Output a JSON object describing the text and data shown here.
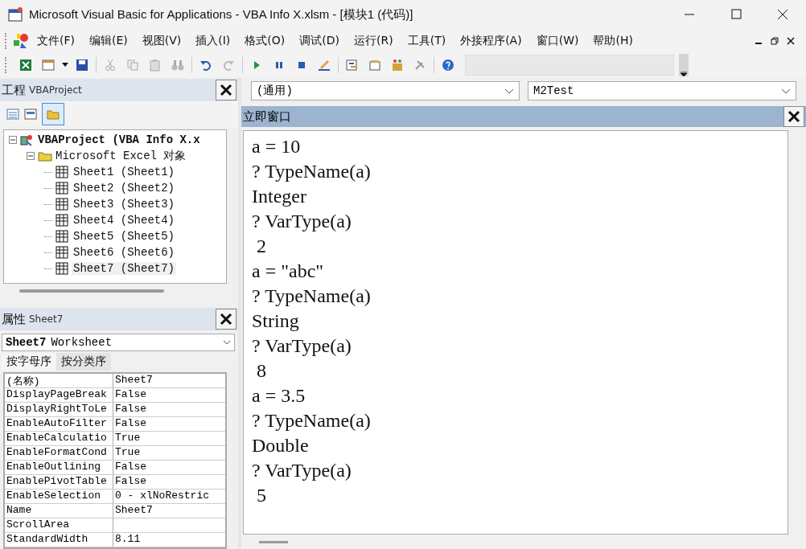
{
  "window": {
    "title": "Microsoft Visual Basic for Applications - VBA Info X.xlsm - [模块1 (代码)]"
  },
  "menu": [
    {
      "label": "文件(F)"
    },
    {
      "label": "编辑(E)"
    },
    {
      "label": "视图(V)"
    },
    {
      "label": "插入(I)"
    },
    {
      "label": "格式(O)"
    },
    {
      "label": "调试(D)"
    },
    {
      "label": "运行(R)"
    },
    {
      "label": "工具(T)"
    },
    {
      "label": "外接程序(A)"
    },
    {
      "label": "窗口(W)"
    },
    {
      "label": "帮助(H)"
    }
  ],
  "project": {
    "title": "工程",
    "subtitle": "VBAProject",
    "tree": [
      {
        "label": "VBAProject (VBA Info X.x",
        "kind": "project",
        "expanded": true,
        "selected": false,
        "children": [
          {
            "label": "Microsoft Excel 对象",
            "kind": "folder",
            "expanded": true,
            "selected": false,
            "children": [
              {
                "label": "Sheet1 (Sheet1)",
                "kind": "sheet",
                "selected": false
              },
              {
                "label": "Sheet2 (Sheet2)",
                "kind": "sheet",
                "selected": false
              },
              {
                "label": "Sheet3 (Sheet3)",
                "kind": "sheet",
                "selected": false
              },
              {
                "label": "Sheet4 (Sheet4)",
                "kind": "sheet",
                "selected": false
              },
              {
                "label": "Sheet5 (Sheet5)",
                "kind": "sheet",
                "selected": false
              },
              {
                "label": "Sheet6 (Sheet6)",
                "kind": "sheet",
                "selected": false
              },
              {
                "label": "Sheet7 (Sheet7)",
                "kind": "sheet",
                "selected": true
              }
            ]
          }
        ]
      }
    ]
  },
  "properties": {
    "title": "属性",
    "subtitle": "Sheet7",
    "object_name": "Sheet7",
    "object_type": "Worksheet",
    "tabs": [
      {
        "label": "按字母序",
        "selected": true
      },
      {
        "label": "按分类序",
        "selected": false
      }
    ],
    "rows": [
      {
        "name": "(名称)",
        "value": "Sheet7"
      },
      {
        "name": "DisplayPageBreak",
        "value": "False"
      },
      {
        "name": "DisplayRightToLe",
        "value": "False"
      },
      {
        "name": "EnableAutoFilter",
        "value": "False"
      },
      {
        "name": "EnableCalculatio",
        "value": "True"
      },
      {
        "name": "EnableFormatCond",
        "value": "True"
      },
      {
        "name": "EnableOutlining",
        "value": "False"
      },
      {
        "name": "EnablePivotTable",
        "value": "False"
      },
      {
        "name": "EnableSelection",
        "value": "0 - xlNoRestric"
      },
      {
        "name": "Name",
        "value": "Sheet7"
      },
      {
        "name": "ScrollArea",
        "value": ""
      },
      {
        "name": "StandardWidth",
        "value": "8.11"
      }
    ]
  },
  "code": {
    "object_dropdown": "(通用)",
    "procedure_dropdown": "M2Test"
  },
  "immediate": {
    "title": "立即窗口",
    "lines": [
      "a = 10",
      "? TypeName(a)",
      "Integer",
      "? VarType(a)",
      " 2",
      "a = \"abc\"",
      "? TypeName(a)",
      "String",
      "? VarType(a)",
      " 8",
      "a = 3.5",
      "? TypeName(a)",
      "Double",
      "? VarType(a)",
      " 5"
    ]
  }
}
